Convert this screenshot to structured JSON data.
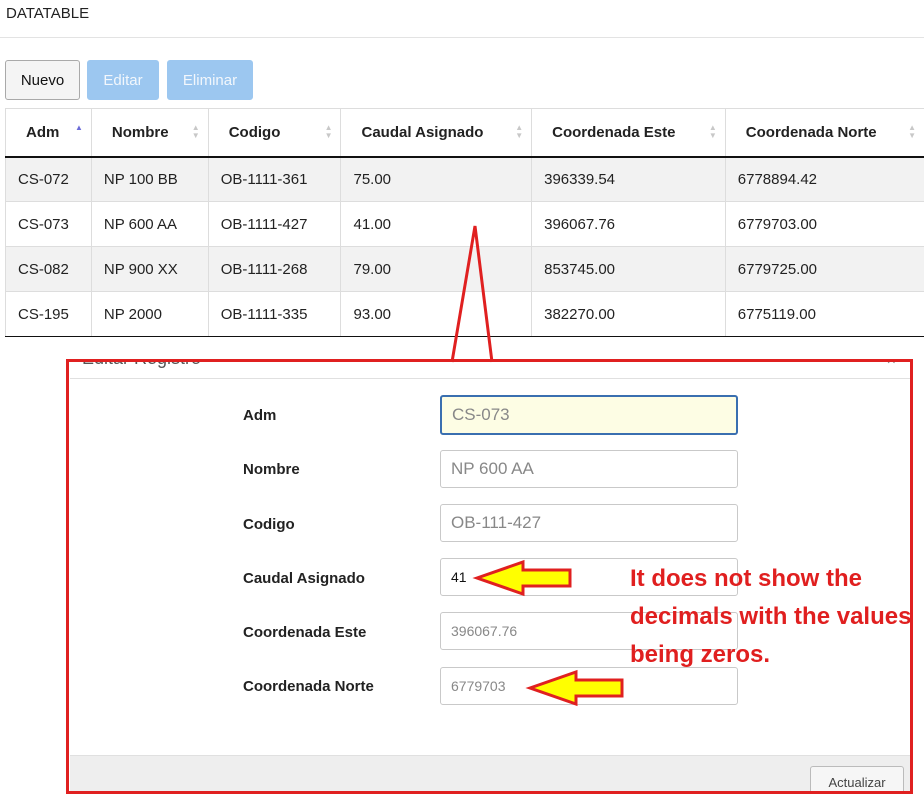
{
  "header": {
    "title": "DATATABLE"
  },
  "toolbar": {
    "new_label": "Nuevo",
    "edit_label": "Editar",
    "delete_label": "Eliminar"
  },
  "table": {
    "columns": [
      "Adm",
      "Nombre",
      "Codigo",
      "Caudal Asignado",
      "Coordenada Este",
      "Coordenada Norte"
    ],
    "sorted_column": "Adm",
    "rows": [
      [
        "CS-072",
        "NP 100 BB",
        "OB-1111-361",
        "75.00",
        "396339.54",
        "6778894.42"
      ],
      [
        "CS-073",
        "NP 600 AA",
        "OB-1111-427",
        "41.00",
        "396067.76",
        "6779703.00"
      ],
      [
        "CS-082",
        "NP 900 XX",
        "OB-1111-268",
        "79.00",
        "853745.00",
        "6779725.00"
      ],
      [
        "CS-195",
        "NP 2000",
        "OB-1111-335",
        "93.00",
        "382270.00",
        "6775119.00"
      ]
    ]
  },
  "modal": {
    "title": "Editar Registro",
    "close_glyph": "×",
    "fields": [
      {
        "label": "Adm",
        "value": "CS-073"
      },
      {
        "label": "Nombre",
        "value": "NP 600 AA"
      },
      {
        "label": "Codigo",
        "value": "OB-111-427"
      },
      {
        "label": "Caudal Asignado",
        "value": "41"
      },
      {
        "label": "Coordenada Este",
        "value": "396067.76"
      },
      {
        "label": "Coordenada Norte",
        "value": "6779703"
      }
    ],
    "update_label": "Actualizar"
  },
  "annotation": {
    "text": "It does not show the decimals with the values being zeros.",
    "color": "#e01f1f",
    "arrow_color": "#ffff00"
  }
}
